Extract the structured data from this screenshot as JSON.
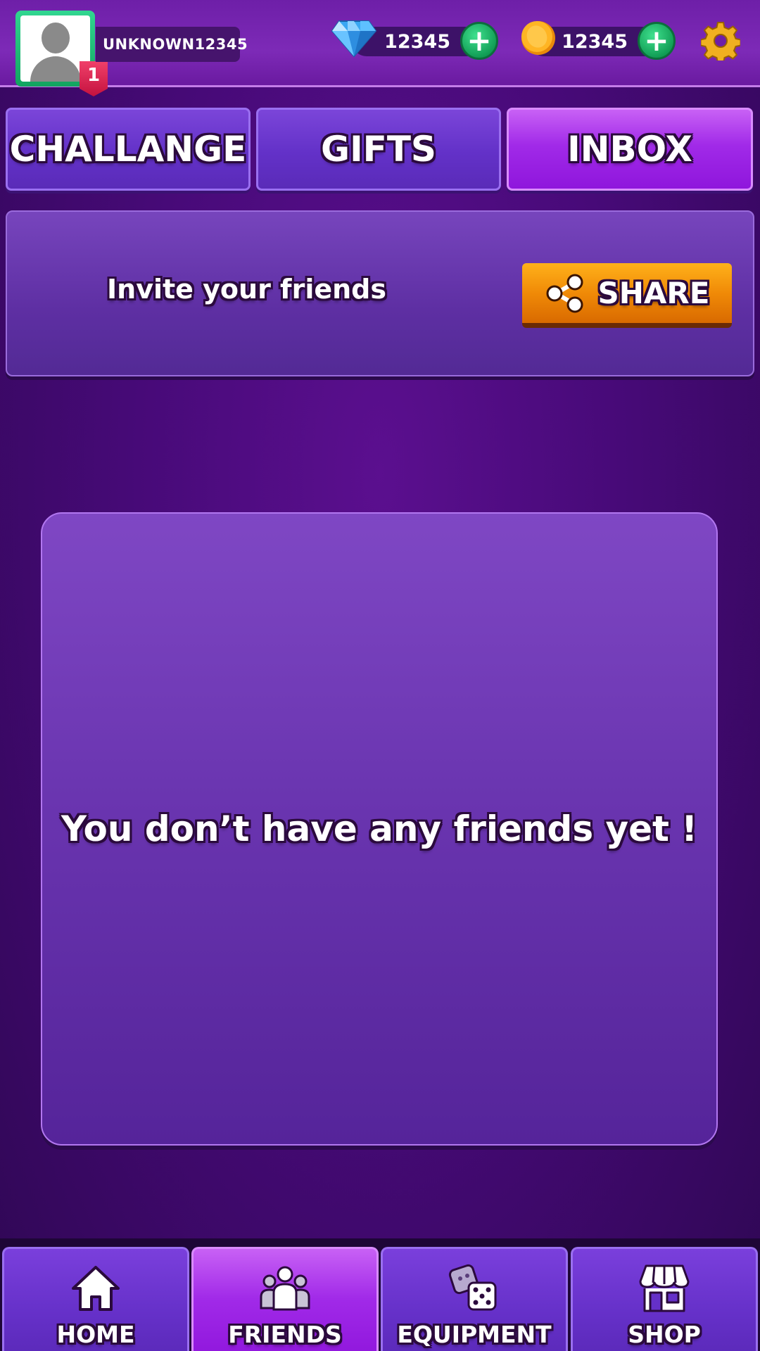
{
  "header": {
    "username": "UNKNOWN12345",
    "level": "1",
    "gems": "12345",
    "coins": "12345",
    "icons": {
      "avatar": "default-avatar-icon",
      "gem": "gem-icon",
      "coin": "coin-icon",
      "plus": "plus-icon",
      "settings": "gear-icon"
    }
  },
  "tabs": [
    {
      "label": "CHALLANGE",
      "active": false
    },
    {
      "label": "GIFTS",
      "active": false
    },
    {
      "label": "INBOX",
      "active": true
    }
  ],
  "invite": {
    "text": "Invite your friends",
    "share_label": "SHARE"
  },
  "friends_list": {
    "empty_message": "You don’t have any friends yet !"
  },
  "bottom_nav": [
    {
      "label": "HOME",
      "icon": "home-icon",
      "active": false
    },
    {
      "label": "FRIENDS",
      "icon": "friends-icon",
      "active": true
    },
    {
      "label": "EQUIPMENT",
      "icon": "dice-icon",
      "active": false
    },
    {
      "label": "SHOP",
      "icon": "shop-icon",
      "active": false
    }
  ],
  "colors": {
    "background": "#4a0b7c",
    "tab_active": "#a12ae8",
    "tab_inactive": "#6331c8",
    "share_button": "#f08a07",
    "plus_button": "#12a460"
  }
}
